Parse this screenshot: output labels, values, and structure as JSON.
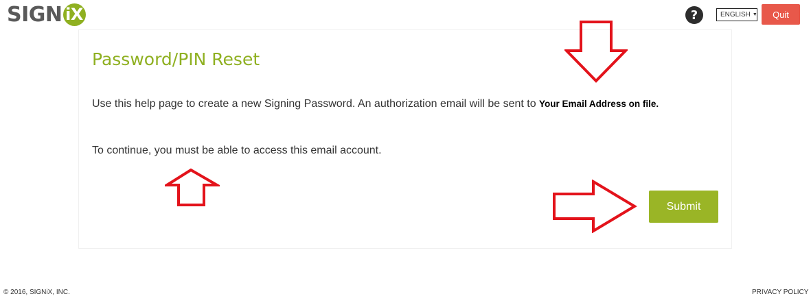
{
  "header": {
    "logo_text": "SIGN",
    "logo_badge": "iX",
    "help_icon": "question-circle-icon",
    "help_label": "?",
    "language": "ENGLISH",
    "quit_label": "Quit"
  },
  "main": {
    "title": "Password/PIN Reset",
    "intro_text": "Use this help page to create a new Signing Password. An authorization email will be sent to",
    "intro_email": "Your Email Address on file.",
    "continue_text": "To continue, you must be able to access this email account.",
    "submit_label": "Submit"
  },
  "footer": {
    "copyright": "© 2016, SIGNiX, INC.",
    "privacy": "PRIVACY POLICY"
  },
  "colors": {
    "brand_green": "#8fb021",
    "submit_green": "#9ab526",
    "quit_red": "#e8584a",
    "annotation_red": "#e3131b"
  }
}
